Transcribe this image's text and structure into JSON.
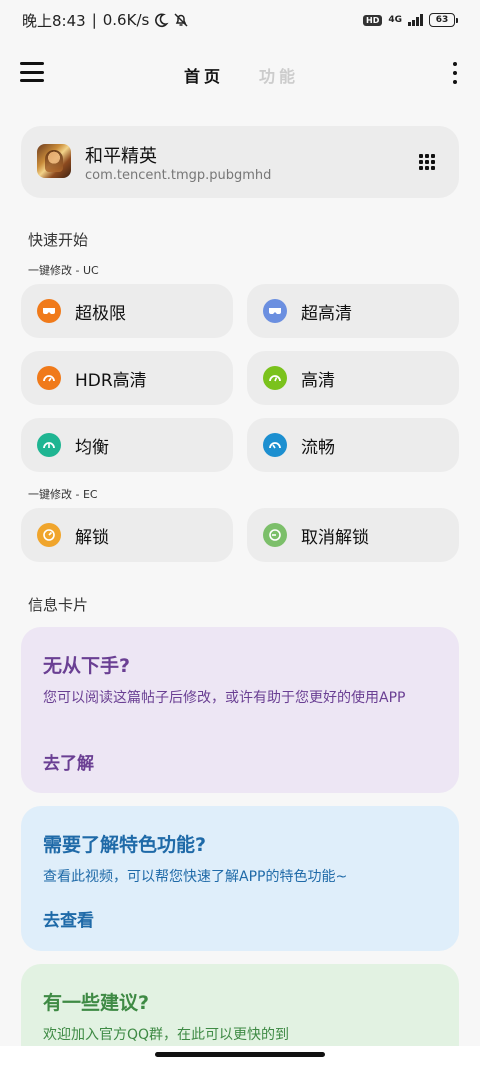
{
  "status_bar": {
    "time": "晚上8:43",
    "speed": "0.6K/s",
    "hd": "HD",
    "network": "4G",
    "battery": "63",
    "icons": [
      "moon-icon",
      "bell-off-icon",
      "signal-icon",
      "battery-icon"
    ]
  },
  "header": {
    "tabs": [
      {
        "label": "首页",
        "active": true
      },
      {
        "label": "功能",
        "active": false
      }
    ]
  },
  "app": {
    "name": "和平精英",
    "package": "com.tencent.tmgp.pubgmhd"
  },
  "quick_start": {
    "title": "快速开始",
    "uc_label": "一键修改 - UC",
    "uc_buttons": [
      {
        "label": "超极限",
        "color": "#f07a1a"
      },
      {
        "label": "超高清",
        "color": "#6b8fe0"
      },
      {
        "label": "HDR高清",
        "color": "#f07a1a"
      },
      {
        "label": "高清",
        "color": "#7ac21c"
      },
      {
        "label": "均衡",
        "color": "#1fb592"
      },
      {
        "label": "流畅",
        "color": "#1c8fd0"
      }
    ],
    "ec_label": "一键修改 - EC",
    "ec_buttons": [
      {
        "label": "解锁",
        "color": "#f0a52c"
      },
      {
        "label": "取消解锁",
        "color": "#7cbf6a"
      }
    ]
  },
  "info_section": {
    "title": "信息卡片",
    "cards": [
      {
        "title": "无从下手?",
        "description": "您可以阅读这篇帖子后修改，或许有助于您更好的使用APP",
        "action": "去了解",
        "bg": "#ede6f4",
        "color": "#6a3f93"
      },
      {
        "title": "需要了解特色功能?",
        "description": "查看此视频，可以帮您快速了解APP的特色功能~",
        "action": "去查看",
        "bg": "#dfeefa",
        "color": "#1f6aa8"
      },
      {
        "title": "有一些建议?",
        "description": "欢迎加入官方QQ群，在此可以更快的到",
        "action": "",
        "bg": "#e2f2e2",
        "color": "#3e8a44"
      }
    ]
  }
}
